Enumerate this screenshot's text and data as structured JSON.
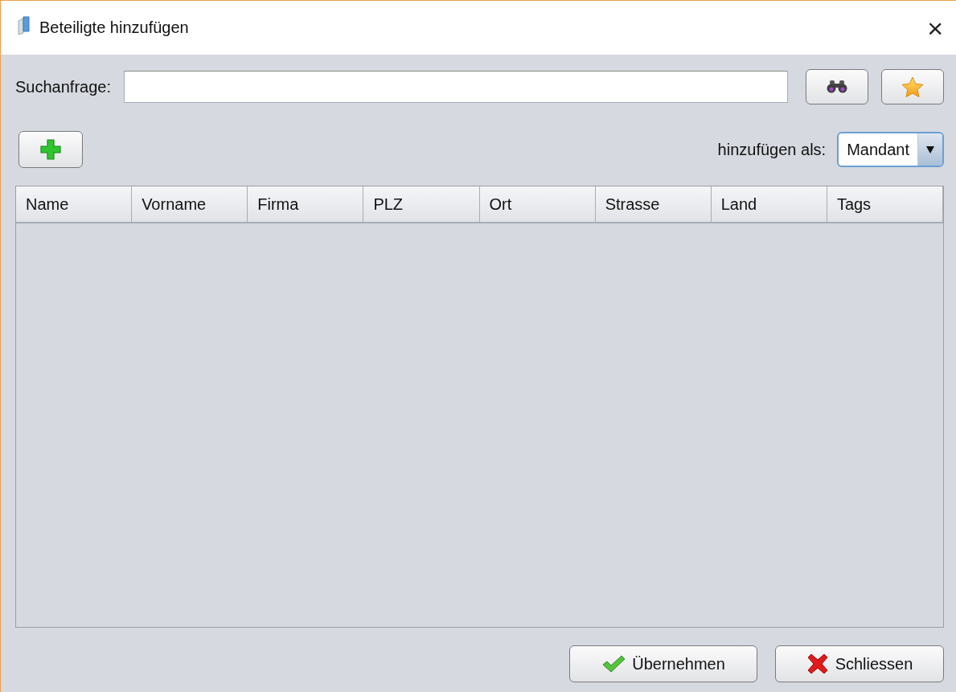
{
  "window": {
    "title": "Beteiligte hinzufügen",
    "close": "×"
  },
  "search": {
    "label": "Suchanfrage:"
  },
  "add_as": {
    "label": "hinzufügen als:",
    "value": "Mandant"
  },
  "table": {
    "columns": [
      "Name",
      "Vorname",
      "Firma",
      "PLZ",
      "Ort",
      "Strasse",
      "Land",
      "Tags"
    ]
  },
  "buttons": [
    {
      "kind": "apply",
      "label": "Übernehmen"
    },
    {
      "kind": "close",
      "label": "Schliessen"
    }
  ]
}
